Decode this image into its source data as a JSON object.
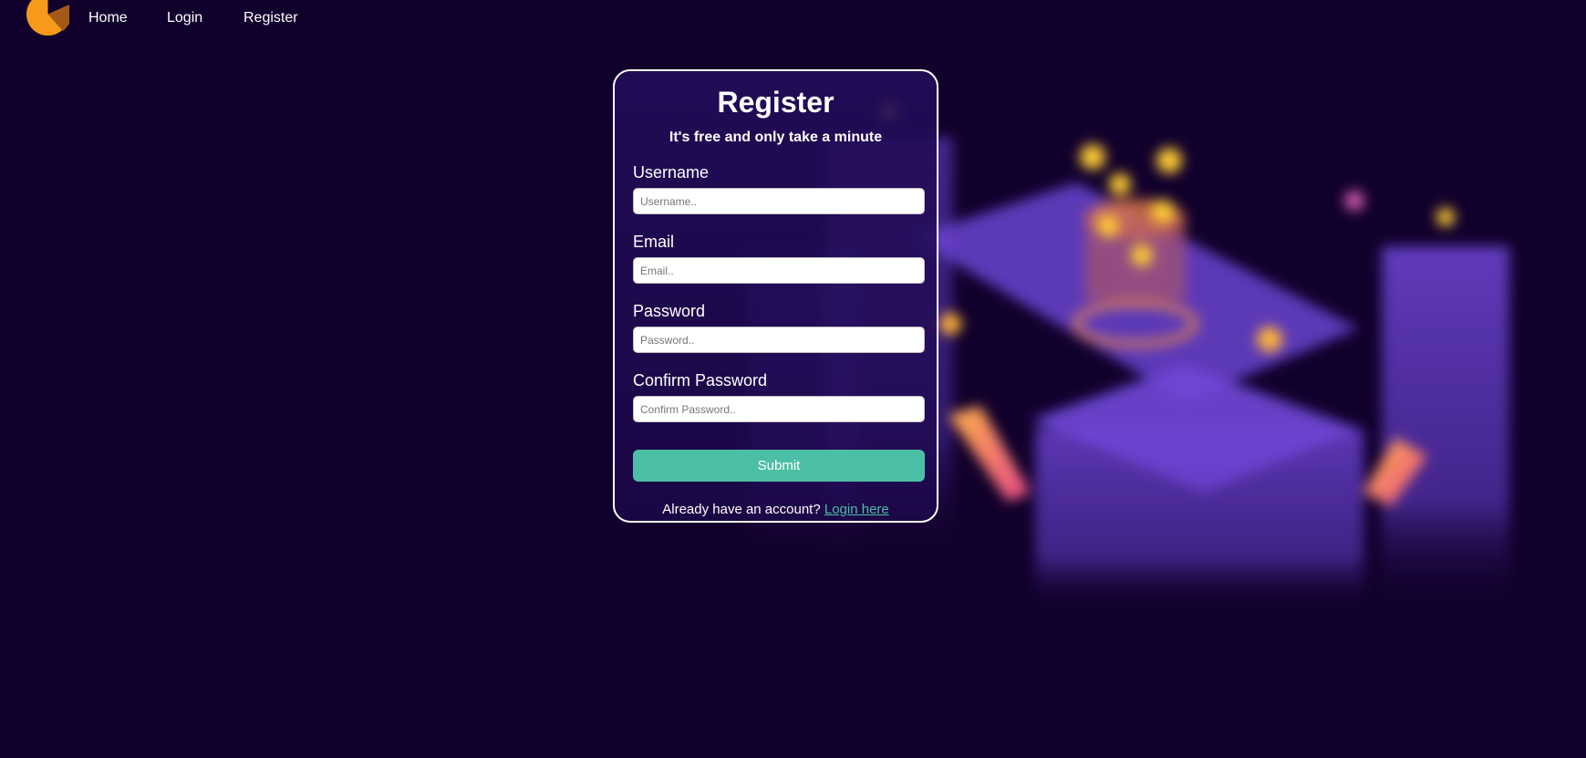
{
  "nav": {
    "logo_colors": {
      "primary": "#f79a1b",
      "secondary": "#a45a16"
    },
    "links": [
      {
        "label": "Home"
      },
      {
        "label": "Login"
      },
      {
        "label": "Register"
      }
    ]
  },
  "form": {
    "title": "Register",
    "subtitle": "It's free and only take a minute",
    "fields": [
      {
        "label": "Username",
        "placeholder": "Username..",
        "value": ""
      },
      {
        "label": "Email",
        "placeholder": "Email..",
        "value": ""
      },
      {
        "label": "Password",
        "placeholder": "Password..",
        "value": ""
      },
      {
        "label": "Confirm Password",
        "placeholder": "Confirm Password..",
        "value": ""
      }
    ],
    "submit_label": "Submit",
    "footer_text": "Already have an account?",
    "footer_link": "Login here"
  },
  "colors": {
    "background": "#12002c",
    "accent": "#4bbfa5",
    "card_border": "#ffffff"
  }
}
